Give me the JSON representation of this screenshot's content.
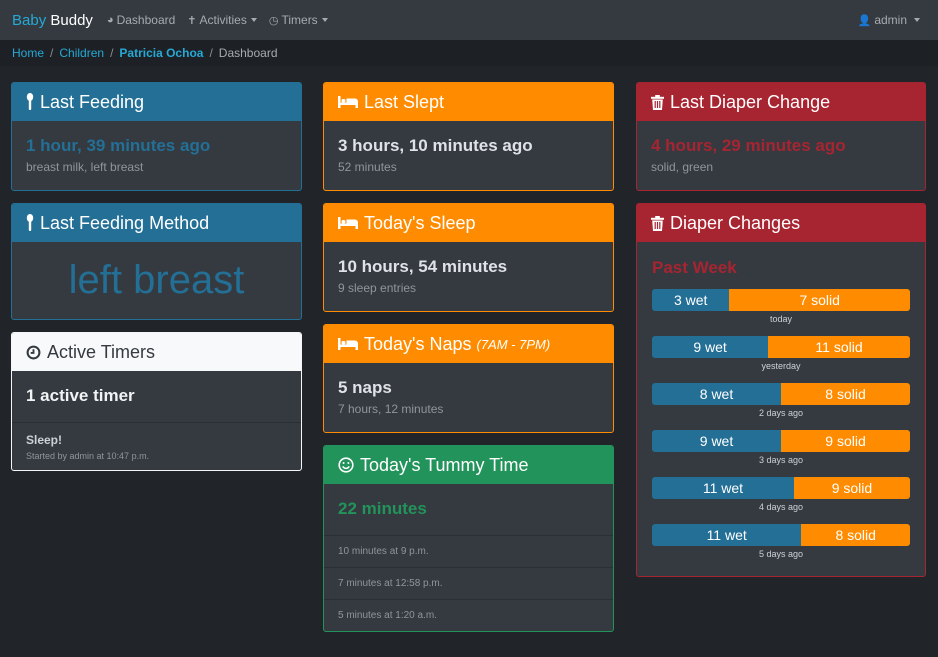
{
  "nav": {
    "brand_part1": "Baby",
    "brand_part2": "Buddy",
    "items": [
      {
        "label": "Dashboard",
        "icon": "dashboard-icon"
      },
      {
        "label": "Activities",
        "icon": "child-icon"
      },
      {
        "label": "Timers",
        "icon": "clock-icon"
      }
    ],
    "user": "admin"
  },
  "breadcrumb": [
    "Home",
    "Children",
    "Patricia Ochoa",
    "Dashboard"
  ],
  "cards": {
    "last_feeding": {
      "title": "Last Feeding",
      "value": "1 hour, 39 minutes ago",
      "sub": "breast milk, left breast"
    },
    "last_feeding_method": {
      "title": "Last Feeding Method",
      "value": "left breast"
    },
    "active_timers": {
      "title": "Active Timers",
      "value": "1 active timer",
      "timer_name": "Sleep!",
      "timer_sub": "Started by admin at 10:47 p.m."
    },
    "last_slept": {
      "title": "Last Slept",
      "value": "3 hours, 10 minutes ago",
      "sub": "52 minutes"
    },
    "todays_sleep": {
      "title": "Today's Sleep",
      "value": "10 hours, 54 minutes",
      "sub": "9 sleep entries"
    },
    "todays_naps": {
      "title": "Today's Naps",
      "title_note": "(7AM - 7PM)",
      "value": "5 naps",
      "sub": "7 hours, 12 minutes"
    },
    "tummy_time": {
      "title": "Today's Tummy Time",
      "value": "22 minutes",
      "entries": [
        "10 minutes at 9 p.m.",
        "7 minutes at 12:58 p.m.",
        "5 minutes at 1:20 a.m."
      ]
    },
    "last_diaper": {
      "title": "Last Diaper Change",
      "value": "4 hours, 29 minutes ago",
      "sub": "solid, green"
    },
    "diaper_changes": {
      "title": "Diaper Changes",
      "subtitle": "Past Week",
      "days": [
        {
          "label": "today",
          "wet": 3,
          "solid": 7,
          "wet_text": "3 wet",
          "solid_text": "7 solid"
        },
        {
          "label": "yesterday",
          "wet": 9,
          "solid": 11,
          "wet_text": "9 wet",
          "solid_text": "11 solid"
        },
        {
          "label": "2 days ago",
          "wet": 8,
          "solid": 8,
          "wet_text": "8 wet",
          "solid_text": "8 solid"
        },
        {
          "label": "3 days ago",
          "wet": 9,
          "solid": 9,
          "wet_text": "9 wet",
          "solid_text": "9 solid"
        },
        {
          "label": "4 days ago",
          "wet": 11,
          "solid": 9,
          "wet_text": "11 wet",
          "solid_text": "9 solid"
        },
        {
          "label": "5 days ago",
          "wet": 11,
          "solid": 8,
          "wet_text": "11 wet",
          "solid_text": "8 solid"
        }
      ]
    }
  },
  "colors": {
    "feeding": "#236f96",
    "sleep": "#ff8c00",
    "diaper": "#a72431",
    "tummy": "#22935a"
  }
}
